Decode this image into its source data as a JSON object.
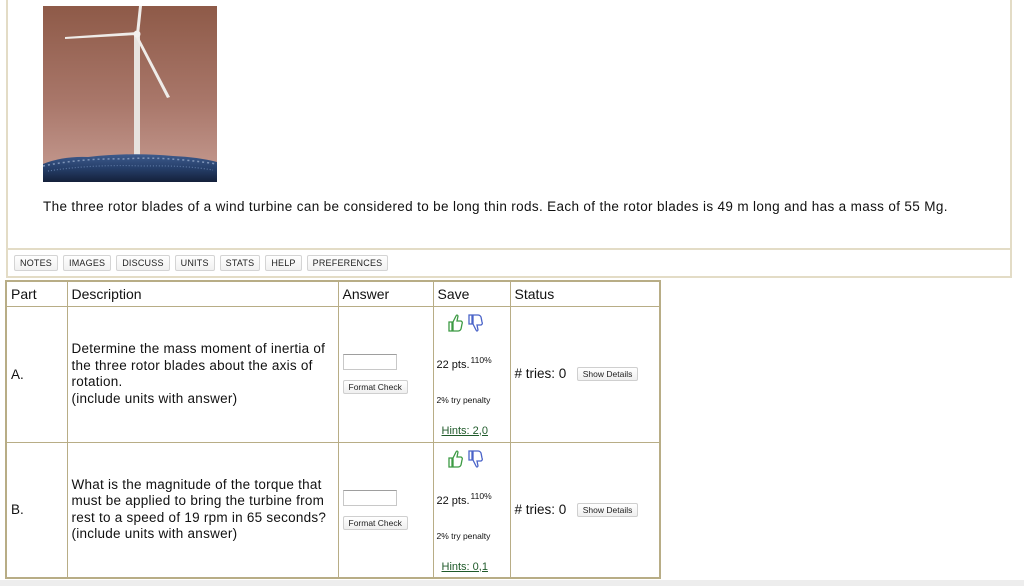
{
  "problem": {
    "statement": "The three rotor blades of a wind turbine can be considered to be long thin rods. Each of the rotor blades is 49 m long and has a mass of 55 Mg."
  },
  "toolbar": {
    "buttons": [
      "NOTES",
      "IMAGES",
      "DISCUSS",
      "UNITS",
      "STATS",
      "HELP",
      "PREFERENCES"
    ]
  },
  "table": {
    "headers": {
      "part": "Part",
      "description": "Description",
      "answer": "Answer",
      "save": "Save",
      "status": "Status"
    },
    "parts": [
      {
        "label": "A.",
        "description": "Determine the mass moment of inertia of the three rotor blades about the axis of rotation.\n(include units with answer)",
        "answer_value": "",
        "format_check": "Format Check",
        "points": "22 pts.",
        "percent": "110%",
        "penalty": "2% try penalty",
        "hints": "Hints: 2,0",
        "tries": "# tries: 0",
        "show_details": "Show Details"
      },
      {
        "label": "B.",
        "description": "What is the magnitude of the torque that must be applied to bring the turbine from rest to a speed of 19 rpm in 65 seconds?\n(include units with answer)",
        "answer_value": "",
        "format_check": "Format Check",
        "points": "22 pts.",
        "percent": "110%",
        "penalty": "2% try penalty",
        "hints": "Hints: 0,1",
        "tries": "# tries: 0",
        "show_details": "Show Details"
      }
    ]
  },
  "icons": {
    "thumbs_up_color": "#3c9a43",
    "thumbs_down_color": "#4a63c8"
  }
}
